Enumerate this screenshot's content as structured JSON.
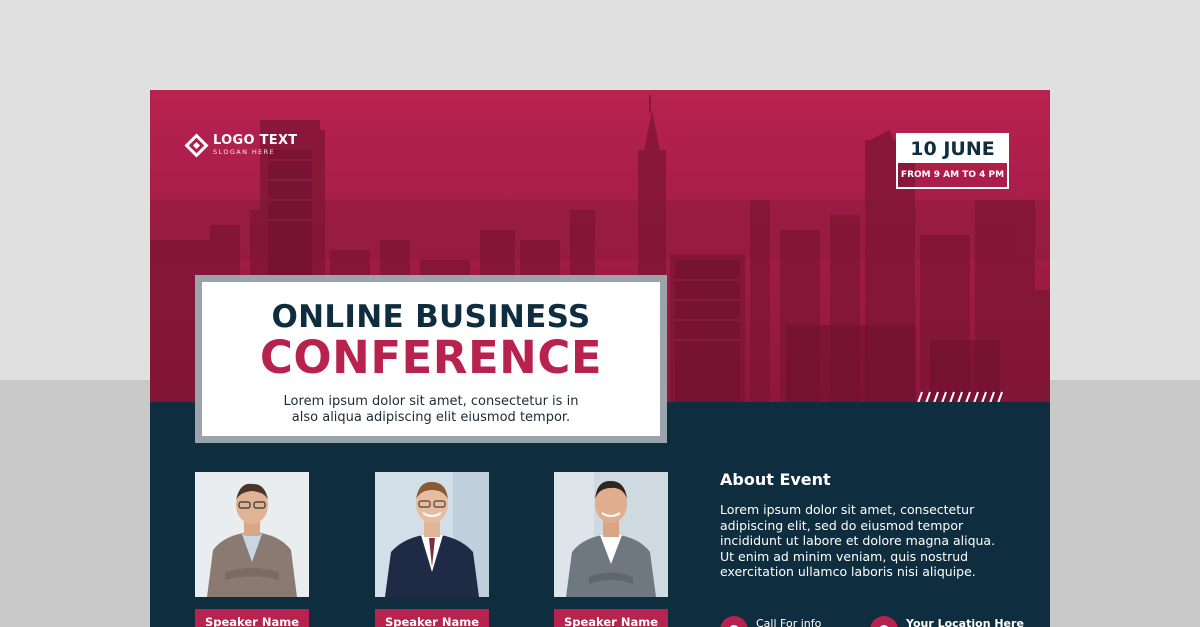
{
  "logo": {
    "name": "LOGO TEXT",
    "slogan": "SLOGAN HERE"
  },
  "event": {
    "date": "10 JUNE",
    "time": "FROM 9 AM TO 4 PM",
    "title_line1": "ONLINE BUSINESS",
    "title_line2": "CONFERENCE",
    "description_line1": "Lorem ipsum dolor sit amet, consectetur is in",
    "description_line2": "also aliqua adipiscing elit eiusmod tempor."
  },
  "speakers": [
    {
      "label": "Speaker Name"
    },
    {
      "label": "Speaker Name"
    },
    {
      "label": "Speaker Name"
    }
  ],
  "about": {
    "title": "About Event",
    "body_lines": [
      "Lorem ipsum dolor sit amet, consectetur",
      "adipiscing elit, sed do eiusmod tempor",
      "incididunt ut labore et dolore magna aliqua.",
      "Ut enim ad minim veniam, quis nostrud",
      "exercitation ullamco laboris nisi aliquipe."
    ]
  },
  "contact": {
    "call_label": "Call For info",
    "location_label": "Your Location Here"
  },
  "colors": {
    "accent": "#b8224f",
    "navy": "#0e2e3f",
    "white": "#ffffff"
  }
}
